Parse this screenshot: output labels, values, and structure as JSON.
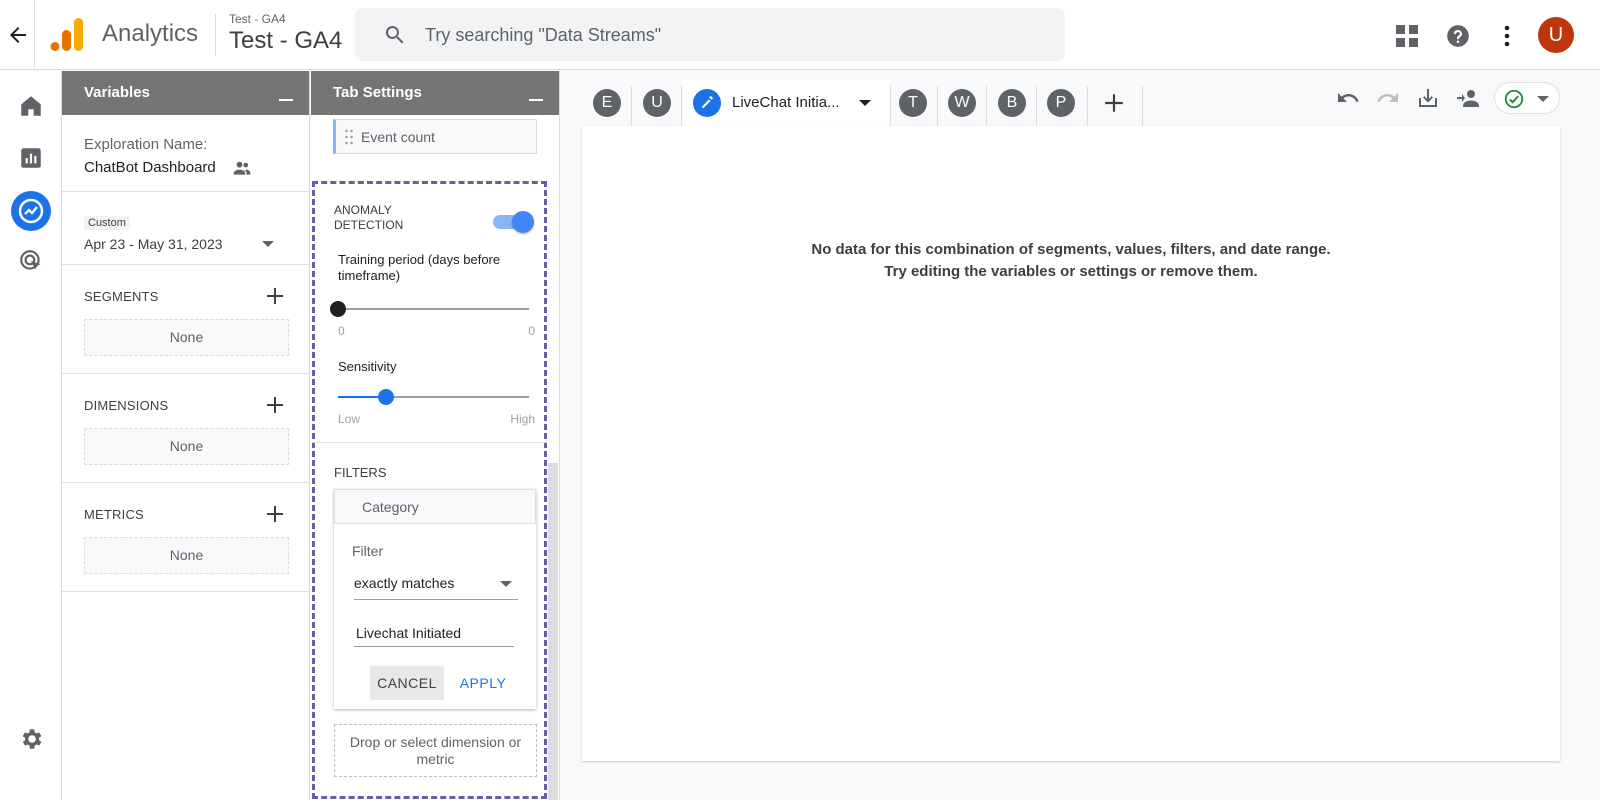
{
  "header": {
    "app_name": "Analytics",
    "property_small": "Test - GA4",
    "property_large": "Test - GA4",
    "search_placeholder": "Try searching \"Data Streams\"",
    "avatar_initial": "U",
    "colors": {
      "avatar": "#bf360c",
      "logo_orange": "#f9ab00",
      "logo_dark": "#e37400"
    }
  },
  "left_nav": {
    "items": [
      "home-icon",
      "reports-icon",
      "explore-icon",
      "advertising-icon"
    ],
    "active": "explore-icon",
    "settings": "gear-icon"
  },
  "variables_panel": {
    "title": "Variables",
    "exploration_label": "Exploration Name:",
    "exploration_name": "ChatBot Dashboard",
    "date_tag": "Custom",
    "date_range": "Apr 23 - May 31, 2023",
    "sections": [
      {
        "title": "SEGMENTS",
        "value": "None"
      },
      {
        "title": "DIMENSIONS",
        "value": "None"
      },
      {
        "title": "METRICS",
        "value": "None"
      }
    ]
  },
  "tab_settings": {
    "title": "Tab Settings",
    "event_chip": "Event count",
    "anomaly_label_1": "ANOMALY",
    "anomaly_label_2": "DETECTION",
    "anomaly_enabled": true,
    "training_label": "Training period (days before timeframe)",
    "training_min": "0",
    "training_max": "0",
    "training_value_fraction": 0,
    "sensitivity_label": "Sensitivity",
    "sensitivity_low": "Low",
    "sensitivity_high": "High",
    "sensitivity_value_fraction": 0.25,
    "filters_title": "FILTERS",
    "filter": {
      "category": "Category",
      "filter_label": "Filter",
      "match_type": "exactly matches",
      "value": "Livechat Initiated",
      "cancel": "CANCEL",
      "apply": "APPLY"
    },
    "drop_text": "Drop or select dimension or metric"
  },
  "canvas": {
    "tabs": [
      {
        "initial": "E"
      },
      {
        "initial": "U"
      },
      {
        "label": "LiveChat Initia...",
        "active": true
      },
      {
        "initial": "T"
      },
      {
        "initial": "W"
      },
      {
        "initial": "B"
      },
      {
        "initial": "P"
      }
    ],
    "no_data_line1": "No data for this combination of segments, values, filters, and date range.",
    "no_data_line2": "Try editing the variables or settings or remove them."
  }
}
